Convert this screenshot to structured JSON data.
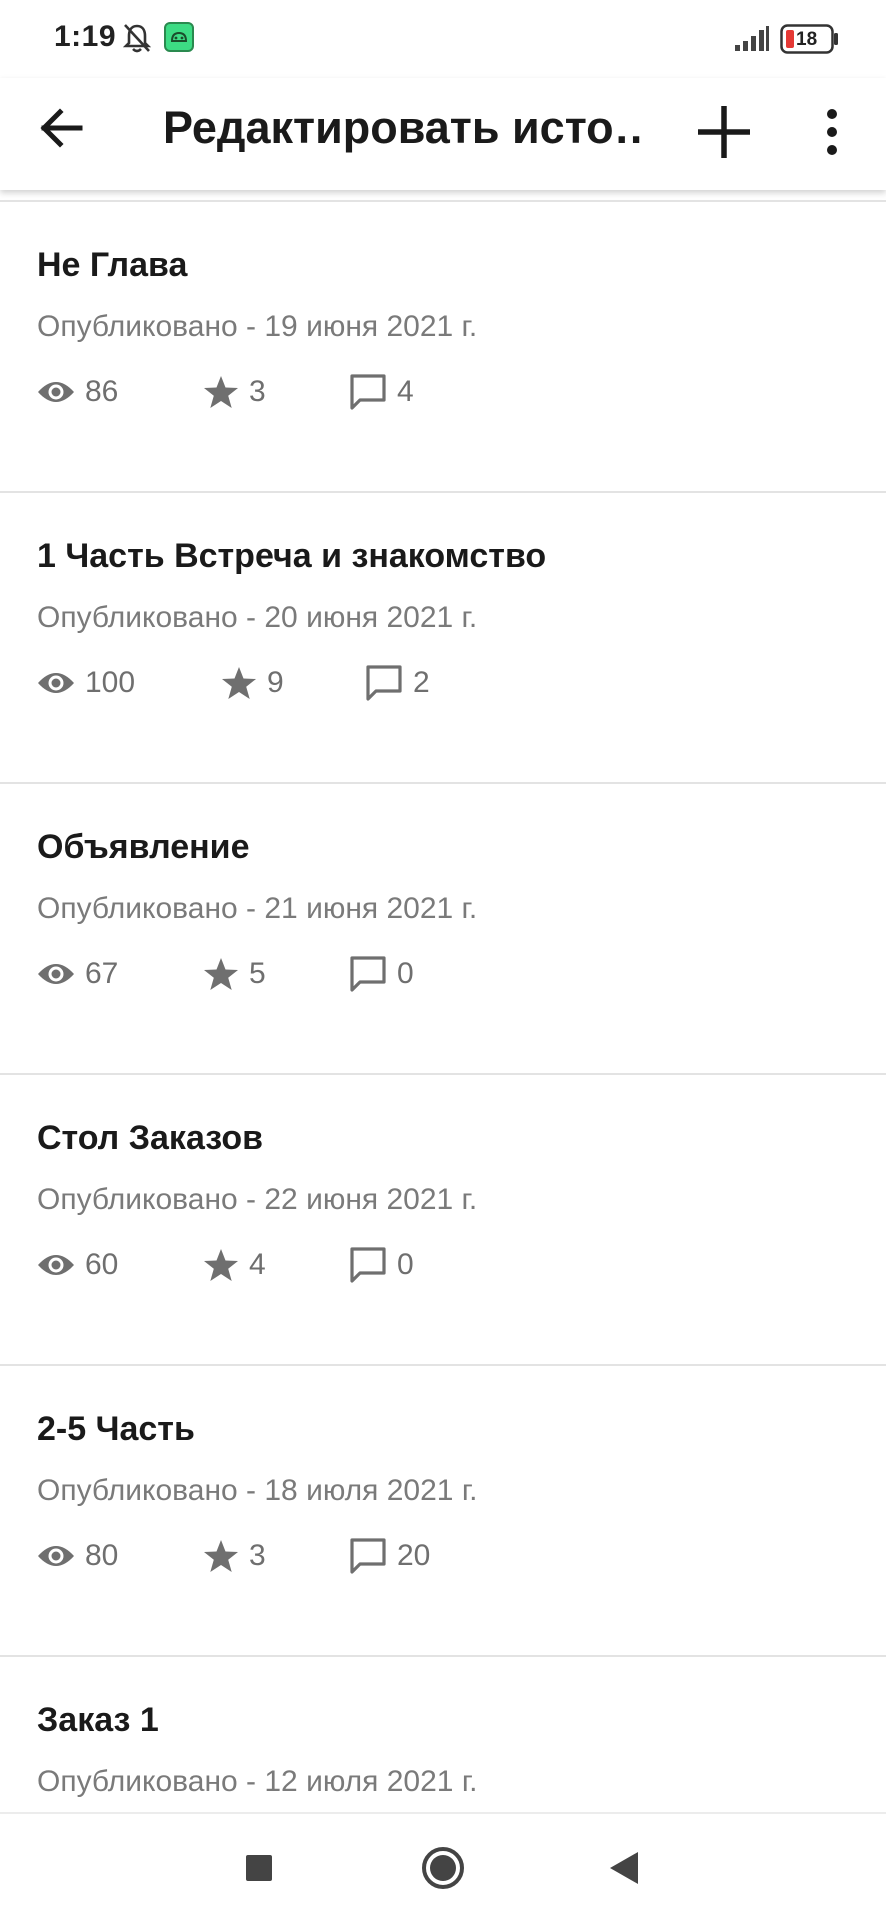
{
  "status_bar": {
    "time": "1:19",
    "battery": "18",
    "icons": [
      "bell-off-icon",
      "android-app-icon",
      "signal-icon",
      "battery-icon"
    ]
  },
  "app_bar": {
    "title": "Редактировать исто…",
    "icons": [
      "back-arrow-icon",
      "plus-icon",
      "more-vert-icon"
    ]
  },
  "parts": [
    {
      "title": "Не Глава",
      "date": "Опубликовано - 19 июня 2021 г.",
      "views": "86",
      "stars": "3",
      "comments": "4"
    },
    {
      "title": "1 Часть Встреча и знакомство",
      "date": "Опубликовано - 20 июня 2021 г.",
      "views": "100",
      "stars": "9",
      "comments": "2"
    },
    {
      "title": "Объявление",
      "date": "Опубликовано - 21 июня 2021 г.",
      "views": "67",
      "stars": "5",
      "comments": "0"
    },
    {
      "title": "Стол Заказов",
      "date": "Опубликовано - 22 июня 2021 г.",
      "views": "60",
      "stars": "4",
      "comments": "0"
    },
    {
      "title": "2-5 Часть",
      "date": "Опубликовано - 18 июля 2021 г.",
      "views": "80",
      "stars": "3",
      "comments": "20"
    },
    {
      "title": "Заказ 1",
      "date": "Опубликовано - 12 июля 2021 г.",
      "views": "",
      "stars": "",
      "comments": ""
    }
  ],
  "nav_bar": {
    "icons": [
      "recents-square-icon",
      "home-circle-icon",
      "back-triangle-icon"
    ]
  },
  "colors": {
    "text_primary": "#1a1a1a",
    "text_secondary": "#7a7a7a",
    "icon_gray": "#6f6f6f",
    "divider": "#e3e3e3",
    "battery_low": "#e53935",
    "android_badge": "#3ddc84"
  }
}
